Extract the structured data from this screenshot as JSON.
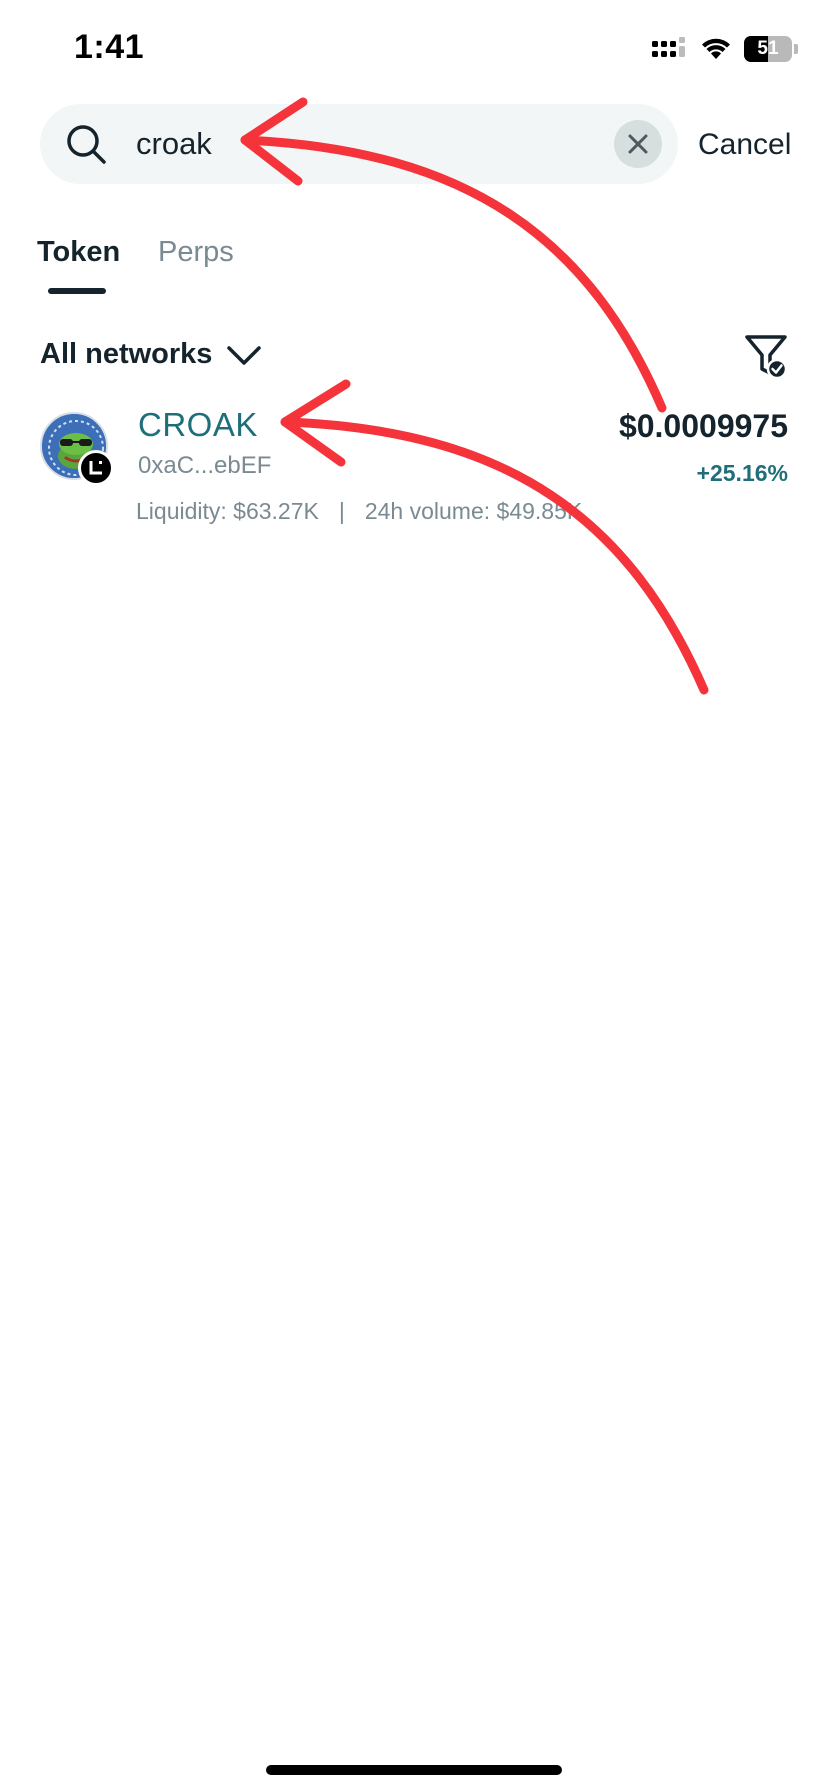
{
  "status_bar": {
    "time": "1:41",
    "battery": "51",
    "battery_level": 0.51,
    "icons": [
      "signal-icon",
      "wifi-icon",
      "battery-icon"
    ]
  },
  "search": {
    "value": "croak",
    "cancel_label": "Cancel"
  },
  "tabs": [
    {
      "label": "Token",
      "active": true
    },
    {
      "label": "Perps",
      "active": false
    }
  ],
  "filters": {
    "networks_label": "All networks"
  },
  "results": [
    {
      "symbol": "CROAK",
      "address": "0xaC...ebEF",
      "price": "$0.0009975",
      "change": "+25.16%",
      "liquidity": "Liquidity: $63.27K",
      "separator": "|",
      "volume": "24h volume: $49.85K"
    }
  ],
  "colors": {
    "accent": "#1f6f7a",
    "text": "#14232c",
    "muted": "#7a8a92",
    "annotation": "#f5333a"
  }
}
